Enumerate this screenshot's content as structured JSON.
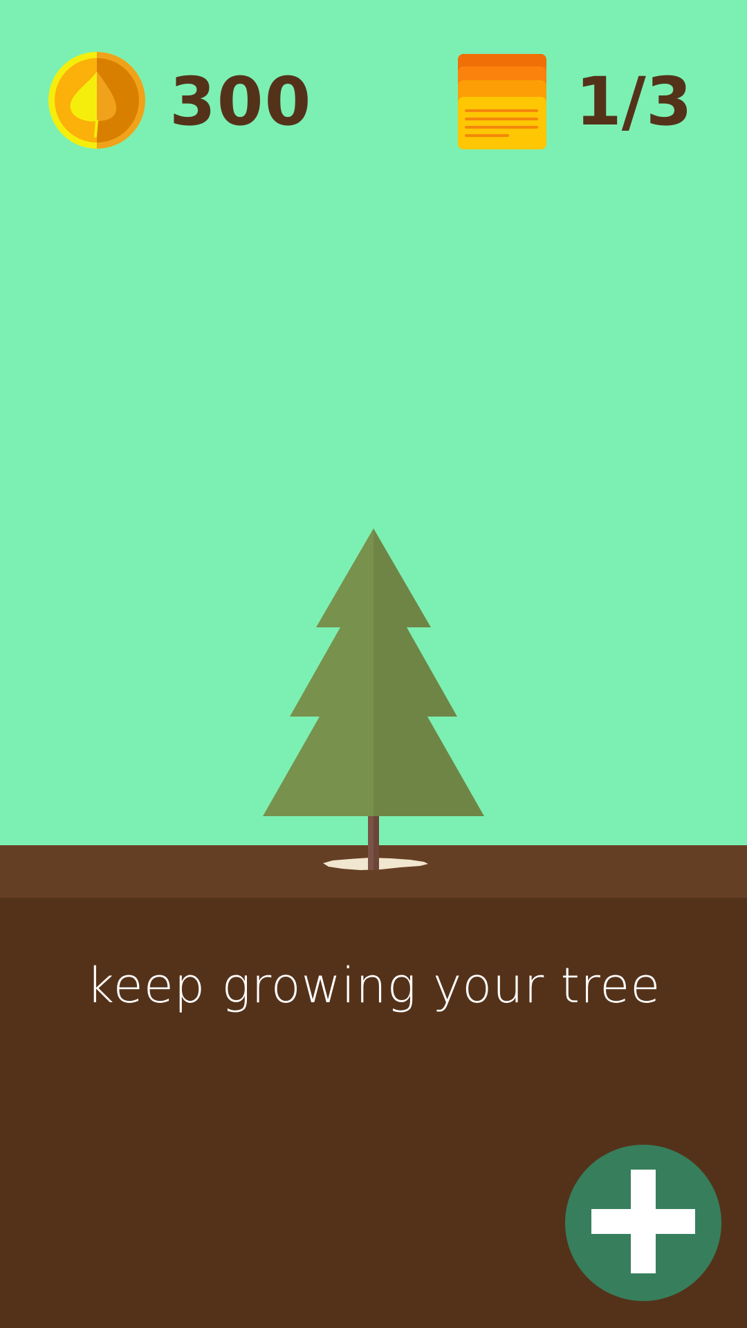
{
  "hud": {
    "coin_icon": "coin-leaf-icon",
    "coin_count": "300",
    "cards_icon": "stacked-cards-icon",
    "card_progress": "1/3"
  },
  "scene": {
    "tree_icon": "pine-tree",
    "message": "keep growing your tree"
  },
  "actions": {
    "add_icon": "plus-icon"
  },
  "colors": {
    "sky": "#7cf0b2",
    "ground_top": "#653f24",
    "ground": "#54321a",
    "text_dark": "#54321a",
    "add_button": "#377e5c"
  }
}
